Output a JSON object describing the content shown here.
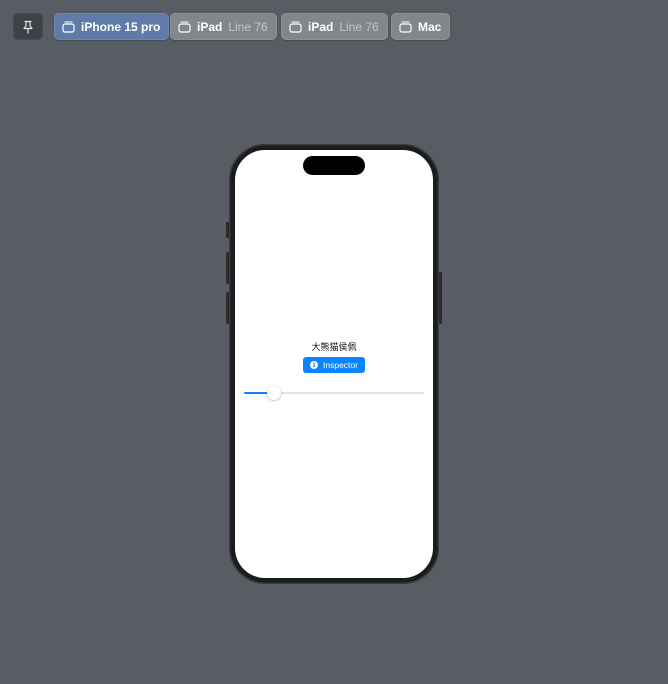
{
  "toolbar": {
    "tabs": [
      {
        "name": "iPhone 15 pro",
        "subtitle": "",
        "active": true
      },
      {
        "name": "iPad",
        "subtitle": "Line 76",
        "active": false
      },
      {
        "name": "iPad",
        "subtitle": "Line 76",
        "active": false
      },
      {
        "name": "Mac",
        "subtitle": "",
        "active": false
      }
    ]
  },
  "preview": {
    "title": "大熊猫侯佩",
    "inspector_button_label": "Inspector",
    "slider_value": 0.14
  },
  "icons": {
    "pin": "pin-icon",
    "device": "device-icon",
    "info": "info-icon"
  },
  "colors": {
    "background": "#585d64",
    "active_tab": "#5f7ca9",
    "inactive_tab": "#83868b",
    "accent": "#0a84ff"
  }
}
